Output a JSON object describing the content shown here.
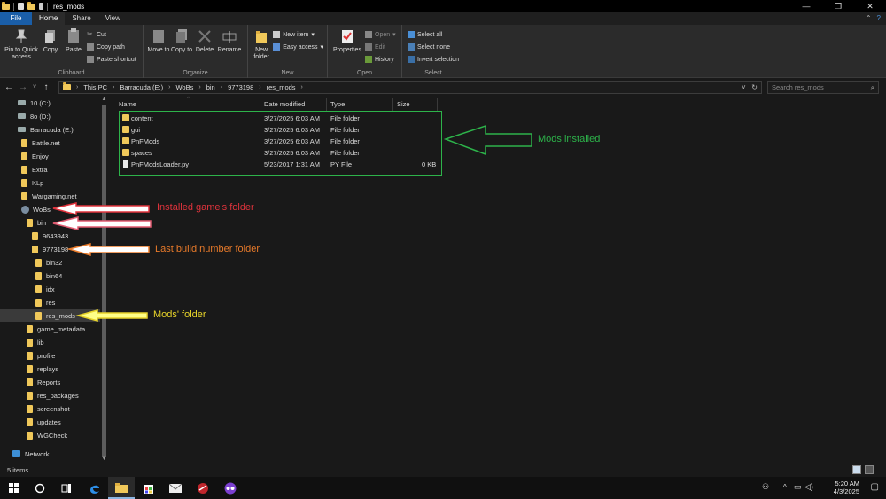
{
  "window": {
    "title": "res_mods",
    "controls": {
      "minimize": "—",
      "maximize": "❐",
      "close": "✕"
    }
  },
  "ribbon_tabs": [
    "File",
    "Home",
    "Share",
    "View"
  ],
  "ribbon": {
    "clipboard": {
      "label": "Clipboard",
      "pin": "Pin to Quick access",
      "copy": "Copy",
      "paste": "Paste",
      "cut": "Cut",
      "copy_path": "Copy path",
      "paste_shortcut": "Paste shortcut"
    },
    "organize": {
      "label": "Organize",
      "move_to": "Move to",
      "copy_to": "Copy to",
      "delete": "Delete",
      "rename": "Rename"
    },
    "new": {
      "label": "New",
      "new_folder": "New folder",
      "new_item": "New item",
      "easy_access": "Easy access"
    },
    "open": {
      "label": "Open",
      "properties": "Properties",
      "open": "Open",
      "edit": "Edit",
      "history": "History"
    },
    "select": {
      "label": "Select",
      "select_all": "Select all",
      "select_none": "Select none",
      "invert": "Invert selection"
    }
  },
  "address": {
    "crumbs": [
      "This PC",
      "Barracuda (E:)",
      "WoBs",
      "bin",
      "9773198",
      "res_mods"
    ],
    "search_placeholder": "Search res_mods"
  },
  "nav_tree": [
    {
      "label": "10 (C:)",
      "kind": "drive"
    },
    {
      "label": "8o (D:)",
      "kind": "drive"
    },
    {
      "label": "Barracuda (E:)",
      "kind": "drive"
    },
    {
      "label": "Battle.net",
      "kind": "folder"
    },
    {
      "label": "Enjoy",
      "kind": "folder"
    },
    {
      "label": "Extra",
      "kind": "folder"
    },
    {
      "label": "KLp",
      "kind": "folder"
    },
    {
      "label": "Wargaming.net",
      "kind": "folder"
    },
    {
      "label": "WoBs",
      "kind": "app"
    },
    {
      "label": "bin",
      "kind": "folder"
    },
    {
      "label": "9643943",
      "kind": "folder"
    },
    {
      "label": "9773198",
      "kind": "folder"
    },
    {
      "label": "bin32",
      "kind": "folder"
    },
    {
      "label": "bin64",
      "kind": "folder"
    },
    {
      "label": "idx",
      "kind": "folder"
    },
    {
      "label": "res",
      "kind": "folder"
    },
    {
      "label": "res_mods",
      "kind": "folder"
    },
    {
      "label": "game_metadata",
      "kind": "folder"
    },
    {
      "label": "lib",
      "kind": "folder"
    },
    {
      "label": "profile",
      "kind": "folder"
    },
    {
      "label": "replays",
      "kind": "folder"
    },
    {
      "label": "Reports",
      "kind": "folder"
    },
    {
      "label": "res_packages",
      "kind": "folder"
    },
    {
      "label": "screenshot",
      "kind": "folder"
    },
    {
      "label": "updates",
      "kind": "folder"
    },
    {
      "label": "WGCheck",
      "kind": "folder"
    },
    {
      "label": "Network",
      "kind": "network"
    }
  ],
  "columns": [
    "Name",
    "Date modified",
    "Type",
    "Size"
  ],
  "files": [
    {
      "name": "content",
      "date": "3/27/2025 6:03 AM",
      "type": "File folder",
      "size": ""
    },
    {
      "name": "gui",
      "date": "3/27/2025 6:03 AM",
      "type": "File folder",
      "size": ""
    },
    {
      "name": "PnFMods",
      "date": "3/27/2025 6:03 AM",
      "type": "File folder",
      "size": ""
    },
    {
      "name": "spaces",
      "date": "3/27/2025 6:03 AM",
      "type": "File folder",
      "size": ""
    },
    {
      "name": "PnFModsLoader.py",
      "date": "5/23/2017 1:31 AM",
      "type": "PY File",
      "size": "0 KB"
    }
  ],
  "annotations": {
    "mods_installed": {
      "text": "Mods installed",
      "color": "#2db34a"
    },
    "game_folder": {
      "text": "Installed game's folder",
      "color": "#e0333c"
    },
    "build_folder": {
      "text": "Last build number folder",
      "color": "#e87a2a"
    },
    "mods_folder": {
      "text": "Mods' folder",
      "color": "#e8d42a"
    }
  },
  "status": {
    "items": "5 items"
  },
  "taskbar": {
    "time": "5:20 AM",
    "date": "4/3/2025"
  }
}
